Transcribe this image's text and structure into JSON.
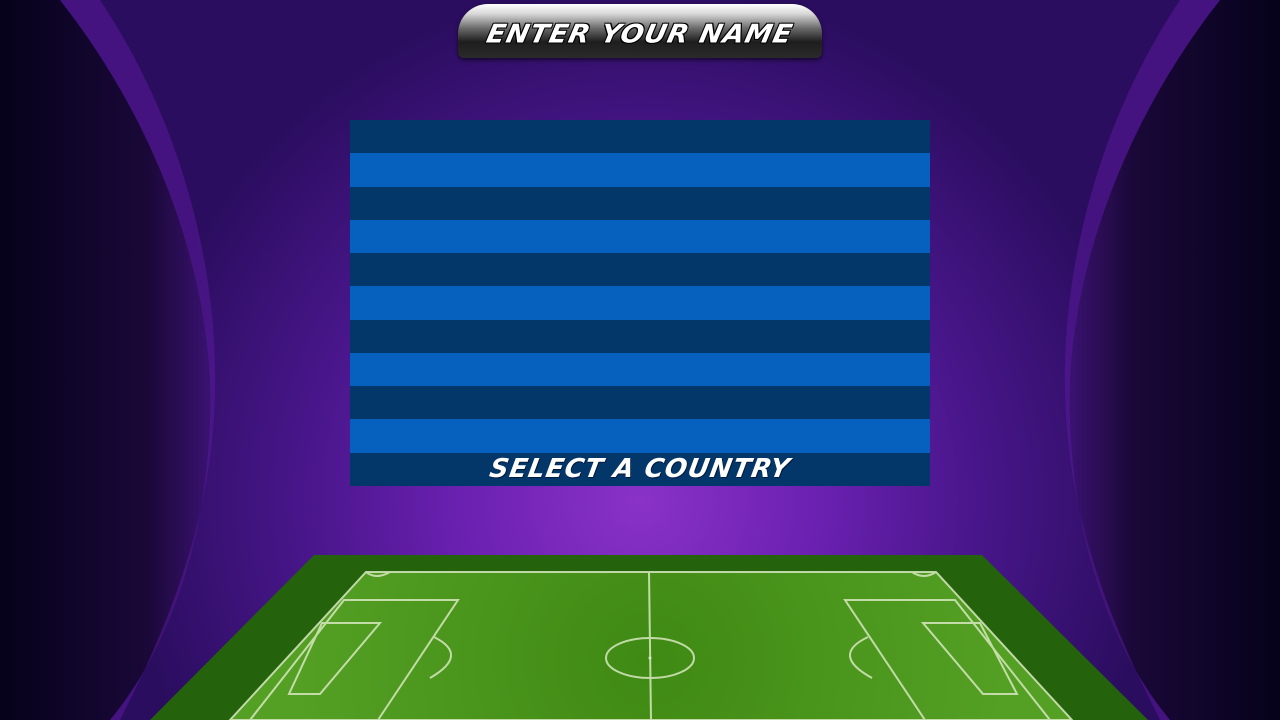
{
  "header": {
    "name_button_label": "ENTER YOUR NAME"
  },
  "country_panel": {
    "select_label": "SELECT A COUNTRY",
    "stripe_colors": [
      "#033669",
      "#0560be"
    ]
  },
  "background": {
    "accent": "#8a32c8",
    "edge": "#0a0520"
  },
  "pitch": {
    "grass": "#4a8f1c",
    "border": "#24620c",
    "lines": "#d8e8c0"
  }
}
